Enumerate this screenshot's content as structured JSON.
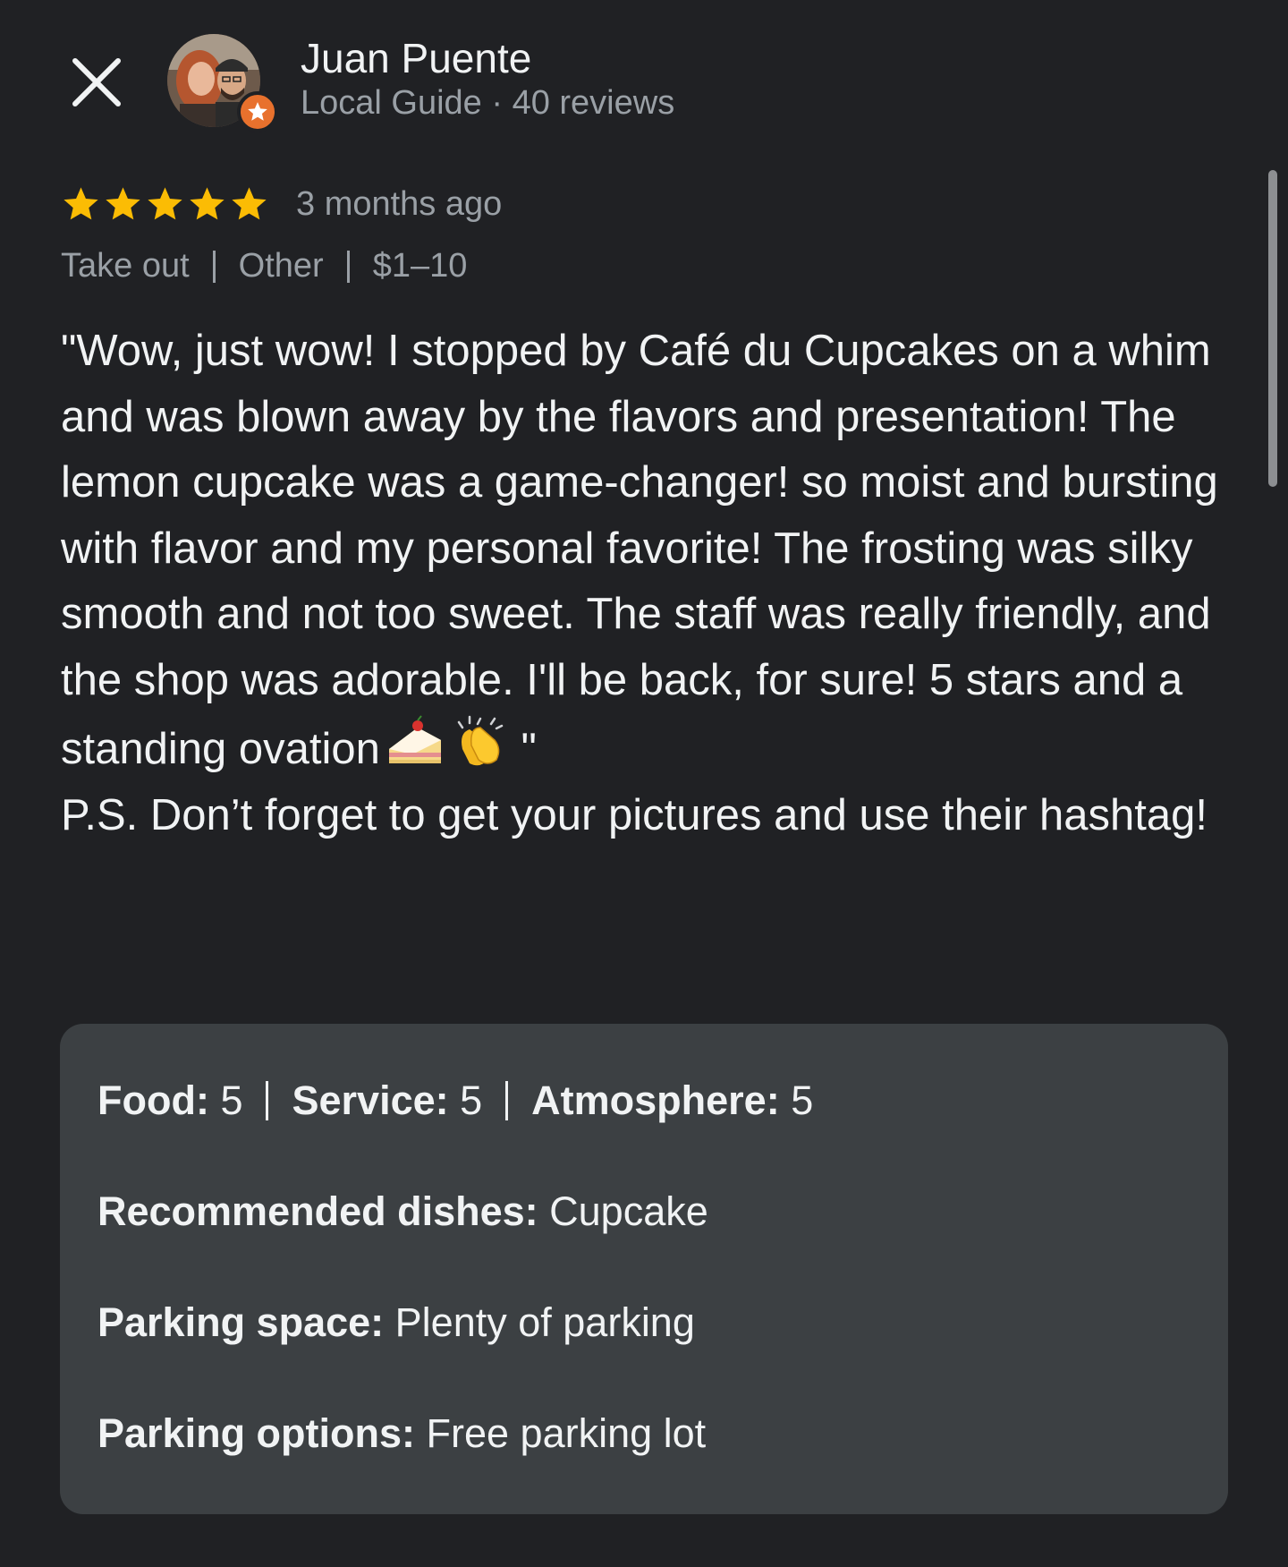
{
  "header": {
    "close_icon": "close-icon",
    "reviewer_name": "Juan Puente",
    "reviewer_meta": "Local Guide · 40 reviews",
    "badge_icon": "local-guide-star-icon"
  },
  "review": {
    "rating": 5,
    "max_rating": 5,
    "date": "3 months ago",
    "tags": [
      "Take out",
      "Other",
      "$1–10"
    ],
    "text_main": "\"Wow, just wow! I stopped by Café du Cupcakes on a whim and was blown away by the flavors and presentation! The lemon cupcake was a game-changer! so moist and bursting with flavor and my personal favorite! The frosting was silky smooth and not too sweet. The staff was really friendly, and the shop was adorable. I'll be back, for sure! 5 stars and a standing ovation",
    "emojis": [
      "cake-slice-icon",
      "clapping-hands-icon"
    ],
    "text_close_quote": " \"",
    "text_ps": "P.S. Don’t forget to get your pictures and use their hashtag!"
  },
  "details": {
    "ratings": [
      {
        "label": "Food:",
        "value": "5"
      },
      {
        "label": "Service:",
        "value": "5"
      },
      {
        "label": "Atmosphere:",
        "value": "5"
      }
    ],
    "recommended_label": "Recommended dishes:",
    "recommended_value": "Cupcake",
    "parking_space_label": "Parking space:",
    "parking_space_value": "Plenty of parking",
    "parking_options_label": "Parking options:",
    "parking_options_value": "Free parking lot"
  },
  "colors": {
    "background": "#202124",
    "card": "#3c4043",
    "star": "#fbbc04",
    "badge": "#e8712d",
    "secondary_text": "#9aa0a6"
  }
}
